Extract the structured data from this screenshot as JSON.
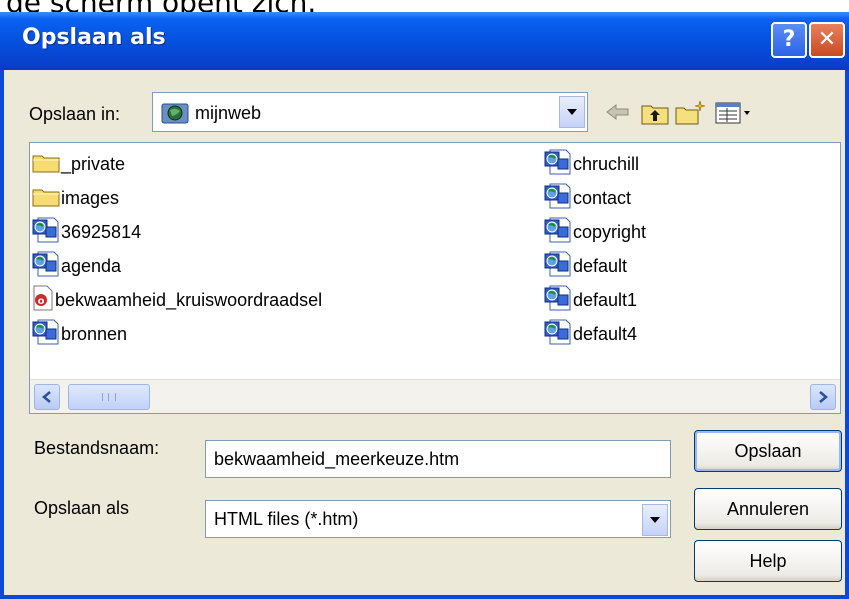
{
  "context_text": "de scherm opent zich.",
  "dialog": {
    "title": "Opslaan als",
    "help_glyph": "?",
    "close_glyph": "✕"
  },
  "location": {
    "label": "Opslaan in:",
    "value": "mijnweb",
    "icon": "web-folder-icon"
  },
  "toolbar": {
    "icons": [
      "back-arrow-icon",
      "up-folder-icon",
      "new-folder-icon",
      "view-menu-icon"
    ]
  },
  "files": {
    "left_column": [
      {
        "name": "_private",
        "icon": "folder-icon"
      },
      {
        "name": "images",
        "icon": "folder-icon"
      },
      {
        "name": "36925814",
        "icon": "html-file-icon"
      },
      {
        "name": "agenda",
        "icon": "html-file-icon"
      },
      {
        "name": "bekwaamheid_kruiswoordraadsel",
        "icon": "generic-file-icon"
      },
      {
        "name": "bronnen",
        "icon": "html-file-icon"
      }
    ],
    "right_column": [
      {
        "name": "chruchill",
        "icon": "html-file-icon"
      },
      {
        "name": "contact",
        "icon": "html-file-icon"
      },
      {
        "name": "copyright",
        "icon": "html-file-icon"
      },
      {
        "name": "default",
        "icon": "html-file-icon"
      },
      {
        "name": "default1",
        "icon": "html-file-icon"
      },
      {
        "name": "default4",
        "icon": "html-file-icon"
      }
    ]
  },
  "filename": {
    "label": "Bestandsnaam:",
    "value": "bekwaamheid_meerkeuze.htm"
  },
  "filetype": {
    "label": "Opslaan als",
    "value": "HTML files (*.htm)"
  },
  "buttons": {
    "save": "Opslaan",
    "cancel": "Annuleren",
    "help": "Help"
  },
  "colors": {
    "titlebar": "#0553e0",
    "dialog_bg": "#ece9d8",
    "border": "#7f9db9",
    "close_button": "#c94a23"
  }
}
